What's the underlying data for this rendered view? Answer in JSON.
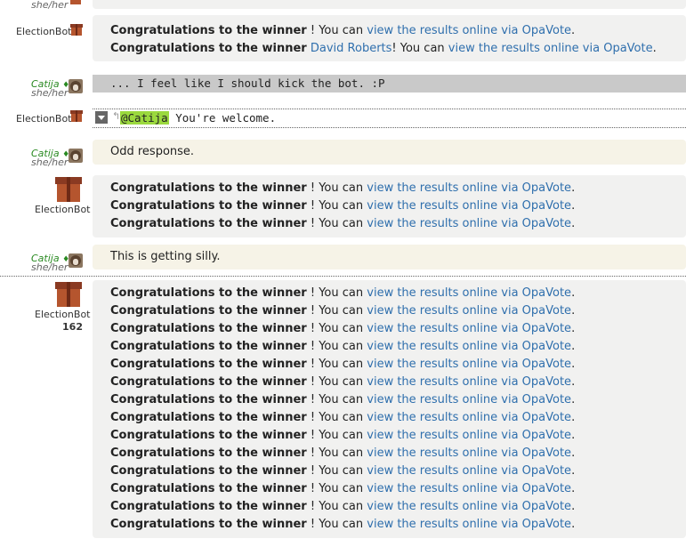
{
  "users": {
    "catija": {
      "name": "Catija",
      "mod_symbol": "♦",
      "pronouns": "she/her"
    },
    "bot": {
      "name": "ElectionBot",
      "message_count": "162"
    }
  },
  "bot_message": {
    "congrats": "Congratulations to the winner",
    "mid": "! You can",
    "link": "view the results online via OpaVote",
    "end": "."
  },
  "messages": {
    "top_line1": {
      "congrats": "Congratulations to the winner",
      "mid": " ! You can ",
      "link": "view the results online via OpaVote",
      "end": "."
    },
    "top_line2": {
      "congrats": "Congratulations to the winner",
      "winner": "David Roberts",
      "mid": "! You can ",
      "link": "view the results online via OpaVote",
      "end": "."
    },
    "kick_bot": "... I feel like I should kick the bot. :P",
    "reply": {
      "mention": "@Catija",
      "text": " You're welcome."
    },
    "odd_response": "Odd response.",
    "silly": "This is getting silly."
  }
}
